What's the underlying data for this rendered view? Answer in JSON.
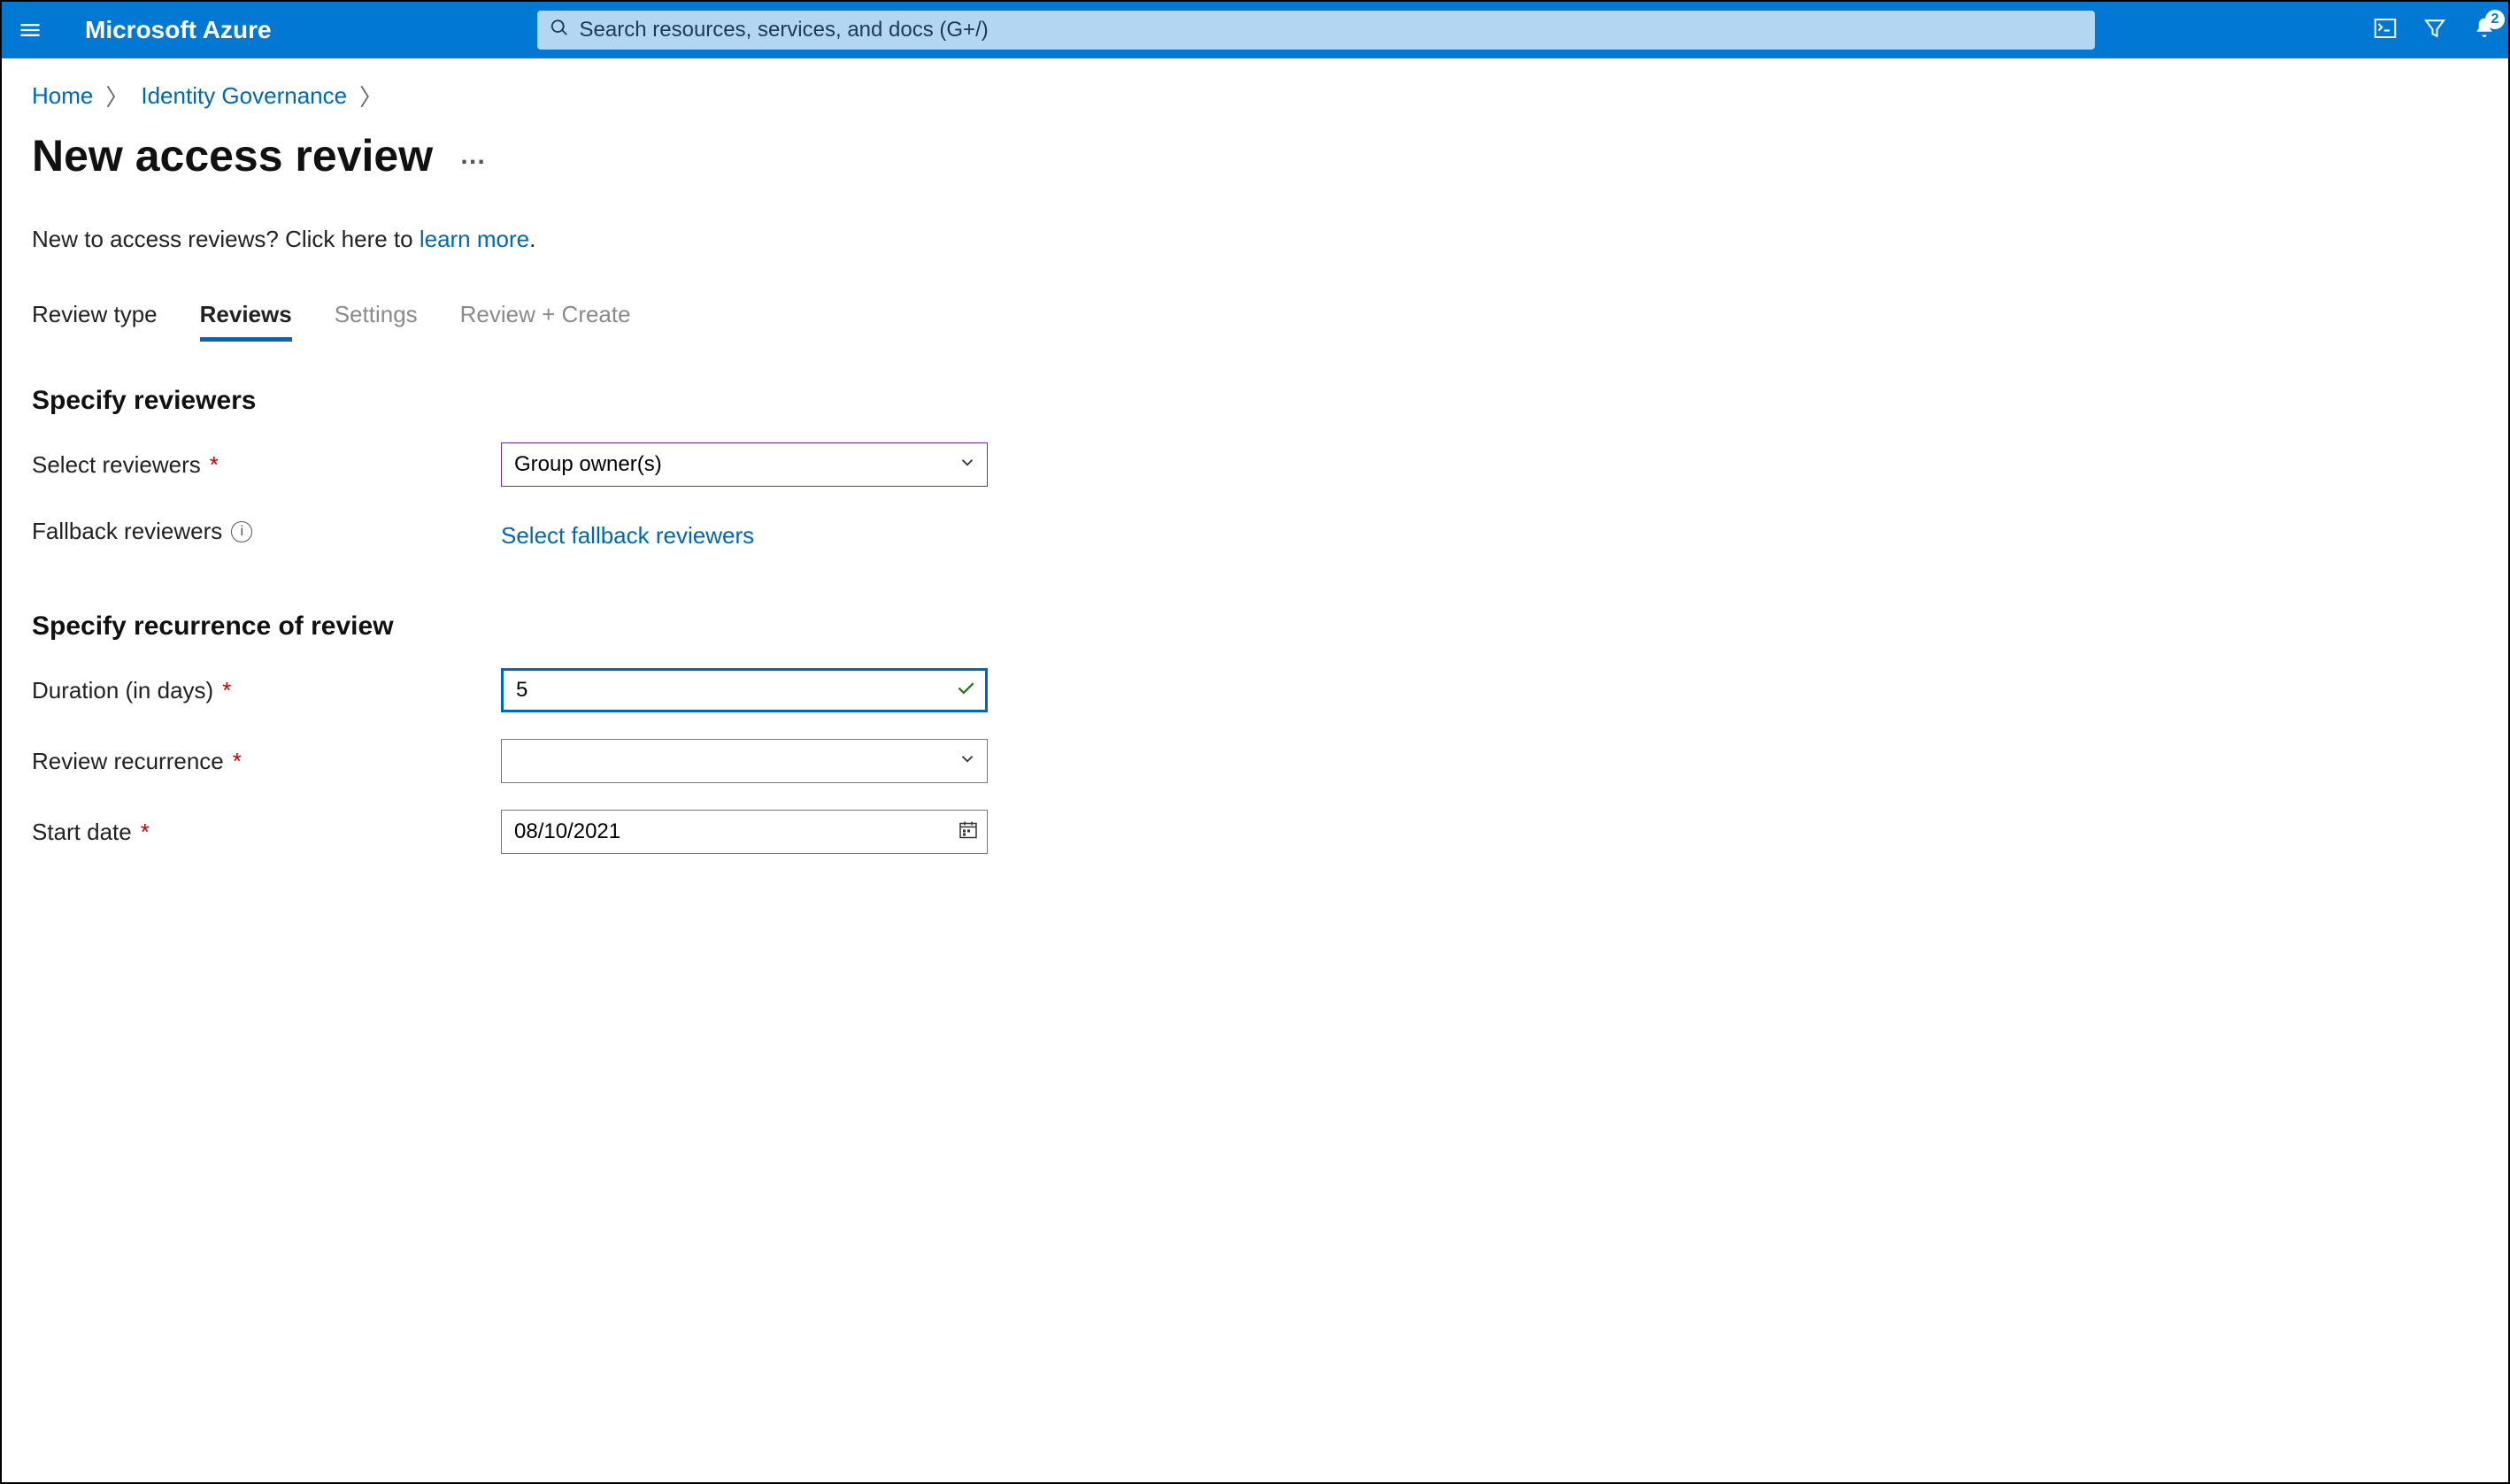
{
  "header": {
    "brand": "Microsoft Azure",
    "search_placeholder": "Search resources, services, and docs (G+/)",
    "notification_count": "2"
  },
  "breadcrumb": {
    "home": "Home",
    "governance": "Identity Governance"
  },
  "page": {
    "title": "New access review",
    "more": "…",
    "note_prefix": "New to access reviews? Click here to ",
    "note_link": "learn more",
    "note_suffix": "."
  },
  "tabs": {
    "review_type": "Review type",
    "reviews": "Reviews",
    "settings": "Settings",
    "review_create": "Review + Create"
  },
  "sections": {
    "reviewers": "Specify reviewers",
    "recurrence": "Specify recurrence of review"
  },
  "labels": {
    "select_reviewers": "Select reviewers",
    "fallback_reviewers": "Fallback reviewers",
    "duration": "Duration (in days)",
    "recurrence": "Review recurrence",
    "start_date": "Start date"
  },
  "values": {
    "reviewers_selected": "Group owner(s)",
    "fallback_action": "Select fallback reviewers",
    "duration": "5",
    "recurrence": "",
    "start_date": "08/10/2021"
  }
}
